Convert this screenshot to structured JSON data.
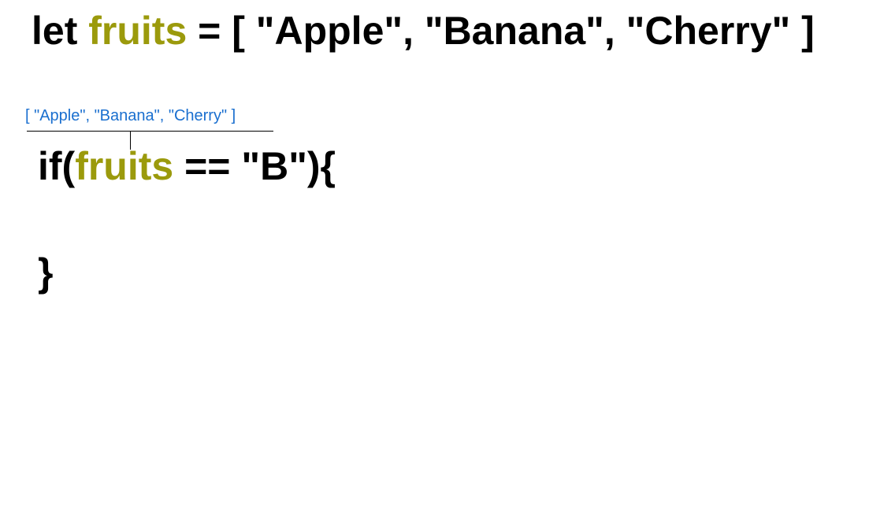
{
  "colors": {
    "keyword": "#000000",
    "variable": "#9b9a0c",
    "annotation": "#1a6fcf",
    "background": "#ffffff"
  },
  "code": {
    "declaration": {
      "keyword": "let ",
      "variable": "fruits",
      "rest": " = [ \"Apple\", \"Banana\", \"Cherry\" ]"
    },
    "condition": {
      "open": "if(",
      "variable": "fruits",
      "rest": " == \"B\"){"
    },
    "closing_brace": "}"
  },
  "annotation": {
    "value": "[ \"Apple\", \"Banana\", \"Cherry\" ]"
  }
}
